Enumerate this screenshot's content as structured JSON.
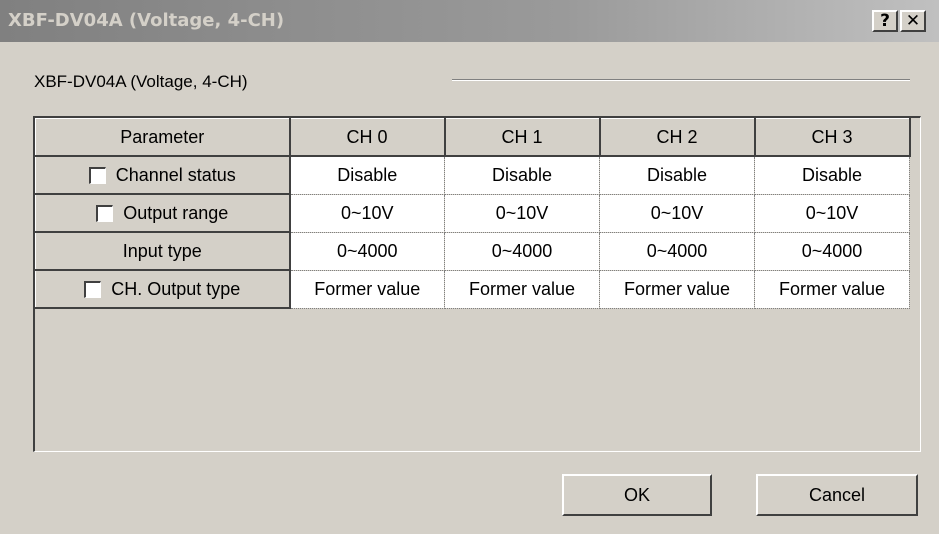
{
  "window": {
    "title": "XBF-DV04A (Voltage, 4-CH)",
    "help_label": "?",
    "close_label": "✕"
  },
  "group": {
    "label": "XBF-DV04A (Voltage, 4-CH)"
  },
  "grid": {
    "header": [
      "Parameter",
      "CH 0",
      "CH 1",
      "CH 2",
      "CH 3"
    ],
    "rows": [
      {
        "label": "Channel status",
        "has_checkbox": true,
        "checked": false,
        "values": [
          "Disable",
          "Disable",
          "Disable",
          "Disable"
        ]
      },
      {
        "label": "Output range",
        "has_checkbox": true,
        "checked": false,
        "values": [
          "0~10V",
          "0~10V",
          "0~10V",
          "0~10V"
        ]
      },
      {
        "label": "Input type",
        "has_checkbox": false,
        "values": [
          "0~4000",
          "0~4000",
          "0~4000",
          "0~4000"
        ]
      },
      {
        "label": "CH. Output type",
        "has_checkbox": true,
        "checked": false,
        "values": [
          "Former value",
          "Former value",
          "Former value",
          "Former value"
        ]
      }
    ]
  },
  "buttons": {
    "ok": "OK",
    "cancel": "Cancel"
  },
  "colors": {
    "face": "#d4d0c8",
    "title_gradient_start": "#808080",
    "cell_bg": "#ffffff"
  }
}
